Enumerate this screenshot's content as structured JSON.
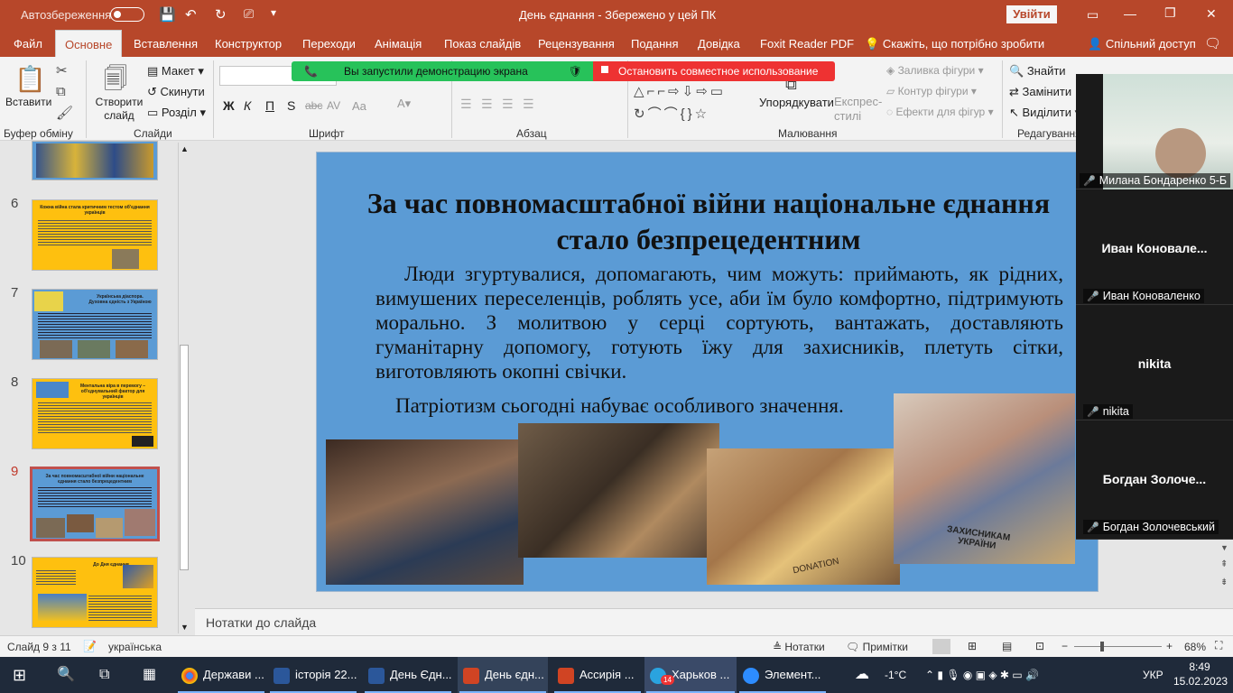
{
  "titlebar": {
    "autosave_label": "Автозбереження",
    "doc_title": "День єднання  -  Збережено у цей ПК",
    "signin_label": "Увійти",
    "min": "—",
    "restore": "❐",
    "close": "✕"
  },
  "tabs": [
    "Файл",
    "Основне",
    "Вставлення",
    "Конструктор",
    "Переходи",
    "Анімація",
    "Показ слайдів",
    "Рецензування",
    "Подання",
    "Довідка",
    "Foxit Reader PDF"
  ],
  "tell_me": "Скажіть, що потрібно зробити",
  "share": "Спільний доступ",
  "ribbon": {
    "paste": "Вставити",
    "new_slide": "Створити слайд",
    "layout": "Макет",
    "reset": "Скинути",
    "section": "Розділ",
    "groups": [
      "Буфер обміну",
      "Слайди",
      "Шрифт",
      "Абзац",
      "Малювання",
      "Редагування"
    ],
    "font_buttons": [
      "Ж",
      "К",
      "П",
      "S",
      "abc",
      "AV",
      "Aa"
    ],
    "arrange": "Упорядкувати",
    "quick_styles": "Експрес-стилі",
    "shape_fill": "Заливка фігури",
    "shape_outline": "Контур фігури",
    "shape_effects": "Ефекти для фігур",
    "find": "Знайти",
    "replace": "Замінити",
    "select": "Виділити"
  },
  "banner": {
    "green": "Вы запустили демонстрацию экрана",
    "red": "Остановить совместное использование"
  },
  "thumbnails": [
    {
      "num": "6",
      "title": "Кожна війна стала критичним тестом об'єднання українців"
    },
    {
      "num": "7",
      "title": "Українська діаспора. Духовна єдність з Україною"
    },
    {
      "num": "8",
      "title": "Ментальна віра в перемогу – об'єднувальний фактор для українців"
    },
    {
      "num": "9",
      "title": "За час повномасштабної війни національне єднання стало безпрецедентним"
    },
    {
      "num": "10",
      "title": "До Дня єднання"
    }
  ],
  "slide": {
    "title": "За час повномасштабної війни національне єднання стало безпрецедентним",
    "body": "Люди згуртувалися, допомагають, чим можуть: приймають, як рідних, вимушених переселенців, роблять усе, аби їм було комфортно, підтримують морально. З молитвою у серці сортують, вантажать, доставляють гуманітарну допомогу, готують їжу для захисників, плетуть сітки, виготовляють окопні свічки.",
    "body2": "Патріотизм сьогодні набуває особливого значення.",
    "box_label": "ЗАХИСНИКАМ УКРАЇНИ",
    "donation_label": "DONATION"
  },
  "notes_placeholder": "Нотатки до слайда",
  "status": {
    "slide_count": "Слайд 9 з 11",
    "language": "українська",
    "notes": "Нотатки",
    "comments": "Примітки",
    "zoom": "68%"
  },
  "zoom_participants": [
    {
      "name": "Милана Бондаренко 5-Б",
      "big": ""
    },
    {
      "name": "Иван Коноваленко",
      "big": "Иван  Коновале..."
    },
    {
      "name": "nikita",
      "big": "nikita"
    },
    {
      "name": "Богдан Золочевський",
      "big": "Богдан  Золоче..."
    }
  ],
  "taskbar": {
    "items": [
      "Держави ...",
      "історія 22...",
      "День Єдн...",
      "День єдн...",
      "Ассирія ...",
      "Харьков ...",
      "Элемент..."
    ],
    "telegram_badge": "14",
    "weather": "-1°C",
    "lang": "УКР",
    "time": "8:49",
    "date": "15.02.2023"
  },
  "colors": {
    "accent": "#b7472a",
    "slide_bg": "#5b9bd5",
    "thumb_yellow": "#fec00f",
    "banner_green": "#27c25a",
    "banner_red": "#ee3232",
    "taskbar": "#1f2a3a"
  }
}
